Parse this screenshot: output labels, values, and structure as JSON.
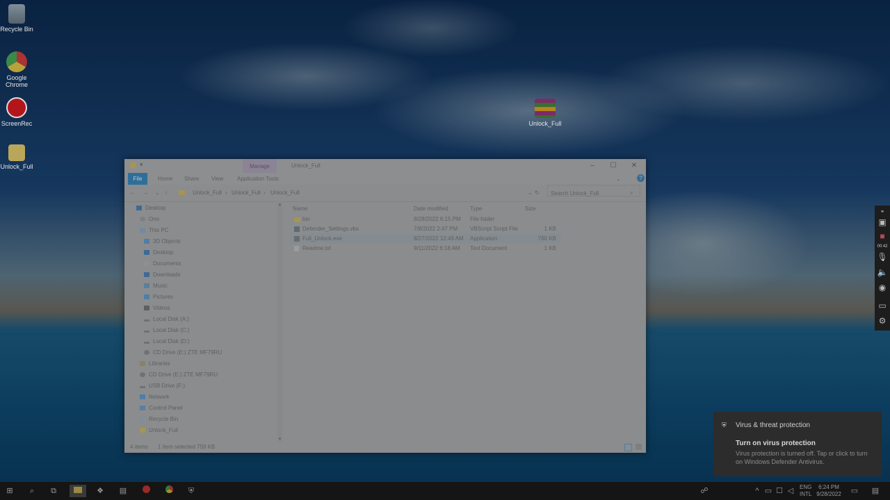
{
  "desktop": {
    "icons": [
      {
        "label": "Recycle Bin",
        "icon": "recycle-bin-icon"
      },
      {
        "label": "Google Chrome",
        "icon": "chrome-icon"
      },
      {
        "label": "ScreenRec",
        "icon": "screenrec-icon"
      },
      {
        "label": "Unlock_Full",
        "icon": "folder-icon"
      },
      {
        "label": "Unlock_Full",
        "icon": "winrar-archive-icon"
      }
    ]
  },
  "explorer": {
    "title": "Unlock_Full",
    "manage_tab": "Manage",
    "ribbon_tabs": [
      "File",
      "Home",
      "Share",
      "View",
      "Application Tools"
    ],
    "breadcrumb": [
      "Unlock_Full",
      "Unlock_Full",
      "Unlock_Full"
    ],
    "search_placeholder": "Search Unlock_Full",
    "nav_items": [
      "Desktop",
      "Ono",
      "This PC",
      "3D Objects",
      "Desktop",
      "Documents",
      "Downloads",
      "Music",
      "Pictures",
      "Videos",
      "Local Disk (A:)",
      "Local Disk (C:)",
      "Local Disk (D:)",
      "CD Drive (E:) ZTE MF79RU",
      "Libraries",
      "CD Drive (E:) ZTE MF79RU",
      "USB Drive (F:)",
      "Network",
      "Control Panel",
      "Recycle Bin",
      "Unlock_Full"
    ],
    "columns": [
      "Name",
      "Date modified",
      "Type",
      "Size"
    ],
    "files": [
      {
        "name": "bin",
        "date": "8/28/2022 6:15 PM",
        "type": "File folder",
        "size": ""
      },
      {
        "name": "Defender_Settings.vbs",
        "date": "7/8/2022 2:47 PM",
        "type": "VBScript Script File",
        "size": "1 KB"
      },
      {
        "name": "Full_Unlock.exe",
        "date": "8/27/2022 12:49 AM",
        "type": "Application",
        "size": "760 KB"
      },
      {
        "name": "Readme.txt",
        "date": "9/11/2022 6:18 AM",
        "type": "Text Document",
        "size": "1 KB"
      }
    ],
    "status_items": "4 items",
    "status_selected": "1 item selected  759 KB"
  },
  "toast": {
    "header": "Virus & threat protection",
    "title": "Turn on virus protection",
    "body": "Virus protection is turned off. Tap or click to turn on Windows Defender Antivirus."
  },
  "taskbar": {
    "lang_top": "ENG",
    "lang_bottom": "INTL",
    "time": "6:24 PM",
    "date": "9/28/2022"
  },
  "recorder_panel": {
    "timer": "00:42"
  }
}
